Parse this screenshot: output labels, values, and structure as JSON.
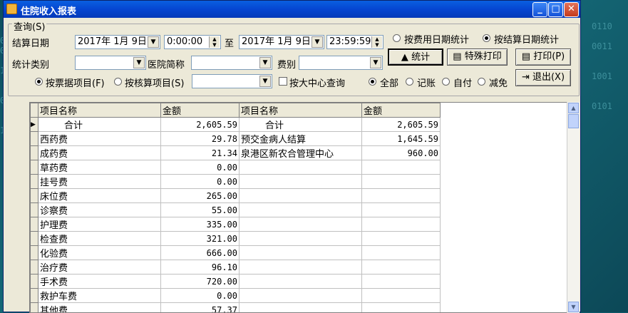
{
  "window": {
    "title": "住院收入报表"
  },
  "query": {
    "group_label": "查询(S)",
    "settle_date_label": "结算日期",
    "start_date": "2017年 1月 9日",
    "start_time": "0:00:00",
    "to_label": "至",
    "end_date": "2017年 1月 9日",
    "end_time": "23:59:59",
    "radio_fee_date": "按费用日期统计",
    "radio_settle_date": "按结算日期统计",
    "category_label": "统计类别",
    "category_value": "",
    "hospital_label": "医院简称",
    "hospital_value": "",
    "fee_label": "费别",
    "fee_value": "",
    "radio_invoice_item": "按票据项目(F)",
    "radio_accounting_item": "按核算项目(S)",
    "item_value": "",
    "big_center_label": "按大中心查询",
    "radio_all": "全部",
    "radio_credit": "记账",
    "radio_self": "自付",
    "radio_waive": "减免"
  },
  "buttons": {
    "stat": "统计",
    "special_print": "特殊打印",
    "print": "打印(P)",
    "exit": "退出(X)"
  },
  "grid": {
    "headers": [
      "项目名称",
      "金额",
      "项目名称",
      "金额"
    ],
    "rows": [
      [
        "合计",
        "2,605.59",
        "合计",
        "2,605.59"
      ],
      [
        "西药费",
        "29.78",
        "预交金病人结算",
        "1,645.59"
      ],
      [
        "成药费",
        "21.34",
        "泉港区新农合管理中心",
        "960.00"
      ],
      [
        "草药费",
        "0.00",
        "",
        ""
      ],
      [
        "挂号费",
        "0.00",
        "",
        ""
      ],
      [
        "床位费",
        "265.00",
        "",
        ""
      ],
      [
        "诊察费",
        "55.00",
        "",
        ""
      ],
      [
        "护理费",
        "335.00",
        "",
        ""
      ],
      [
        "检查费",
        "321.00",
        "",
        ""
      ],
      [
        "化验费",
        "666.00",
        "",
        ""
      ],
      [
        "治疗费",
        "96.10",
        "",
        ""
      ],
      [
        "手术费",
        "720.00",
        "",
        ""
      ],
      [
        "救护车费",
        "0.00",
        "",
        ""
      ],
      [
        "其他费",
        "57.37",
        "",
        ""
      ]
    ]
  },
  "colors": {
    "titlebar": "#0546d1",
    "window_bg": "#ece9d8",
    "desktop": "#0f5a6b"
  }
}
